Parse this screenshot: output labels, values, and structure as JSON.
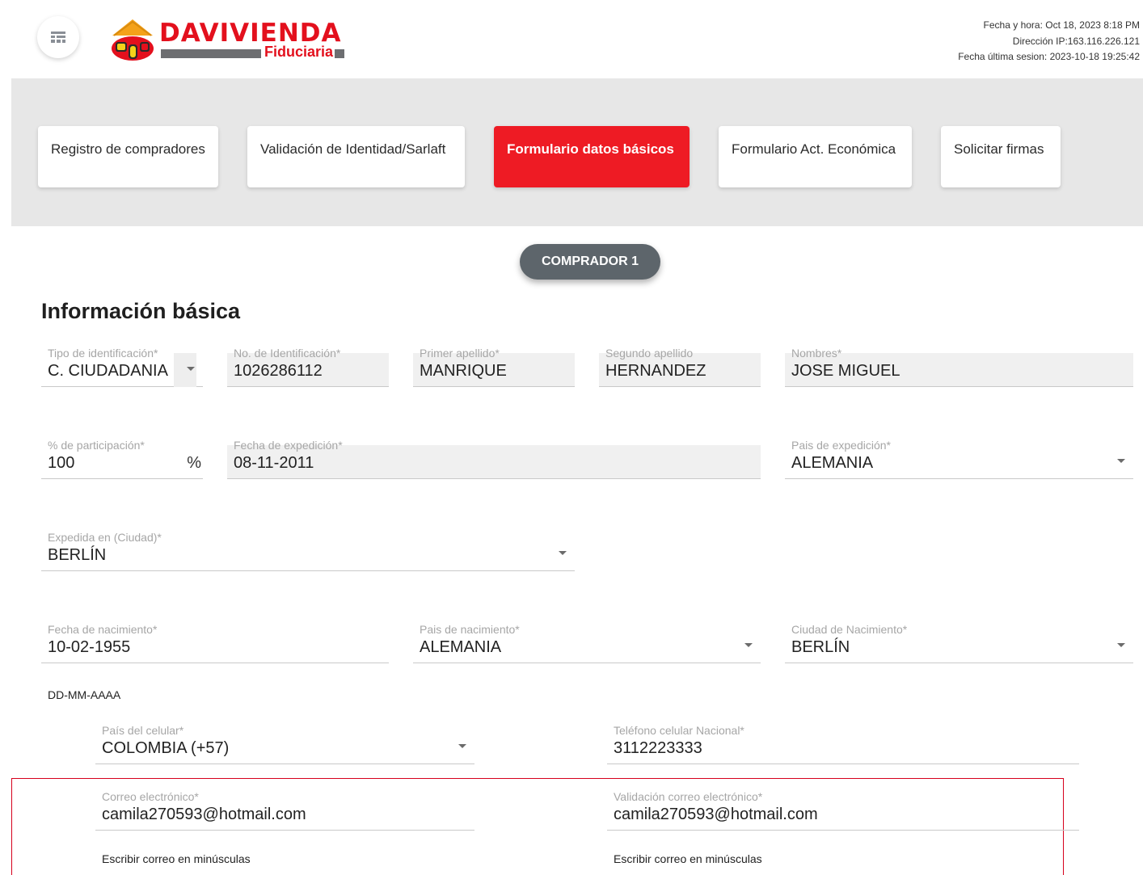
{
  "header": {
    "brand_name": "DAVIVIENDA",
    "brand_sub": "Fiduciaria",
    "session_datetime": "Fecha y hora: Oct 18, 2023 8:18 PM",
    "session_ip": "Dirección IP:163.116.226.121",
    "session_last": "Fecha última sesion: 2023-10-18 19:25:42"
  },
  "steps": [
    {
      "label": "Registro de compradores"
    },
    {
      "label": "Validación de Identidad/Sarlaft"
    },
    {
      "label": "Formulario datos básicos"
    },
    {
      "label": "Formulario Act. Económica"
    },
    {
      "label": "Solicitar firmas"
    }
  ],
  "buyer_button": "COMPRADOR 1",
  "section_title": "Información básica",
  "fields": {
    "tipo_id": {
      "label": "Tipo de identificación*",
      "value": "C. CIUDADANIA"
    },
    "no_id": {
      "label": "No. de Identificación*",
      "value": "1026286112"
    },
    "primer_apellido": {
      "label": "Primer apellido*",
      "value": "MANRIQUE"
    },
    "segundo_apellido": {
      "label": "Segundo apellido",
      "value": "HERNANDEZ"
    },
    "nombres": {
      "label": "Nombres*",
      "value": "JOSE MIGUEL"
    },
    "participacion": {
      "label": "% de participación*",
      "value": "100",
      "suffix": "%"
    },
    "fecha_expedicion": {
      "label": "Fecha de expedición*",
      "value": "08-11-2011"
    },
    "pais_expedicion": {
      "label": "Pais de expedición*",
      "value": "ALEMANIA"
    },
    "expedida_en": {
      "label": "Expedida en (Ciudad)*",
      "value": "BERLÍN"
    },
    "fecha_nacimiento": {
      "label": "Fecha de nacimiento*",
      "value": "10-02-1955",
      "hint": "DD-MM-AAAA"
    },
    "pais_nacimiento": {
      "label": "Pais de nacimiento*",
      "value": "ALEMANIA"
    },
    "ciudad_nacimiento": {
      "label": "Ciudad de Nacimiento*",
      "value": "BERLÍN"
    },
    "pais_celular": {
      "label": "País del celular*",
      "value": "COLOMBIA (+57)"
    },
    "telefono": {
      "label": "Teléfono celular Nacional*",
      "value": "3112223333"
    },
    "correo": {
      "label": "Correo electrónico*",
      "value": "camila270593@hotmail.com",
      "hint": "Escribir correo en minúsculas"
    },
    "correo_validacion": {
      "label": "Validación correo electrónico*",
      "value": "camila270593@hotmail.com",
      "hint": "Escribir correo en minúsculas"
    }
  },
  "colors": {
    "accent": "#ee1b24",
    "button_dark": "#5d656b",
    "band": "#e7e7e7",
    "highlight": "#d6001c"
  }
}
